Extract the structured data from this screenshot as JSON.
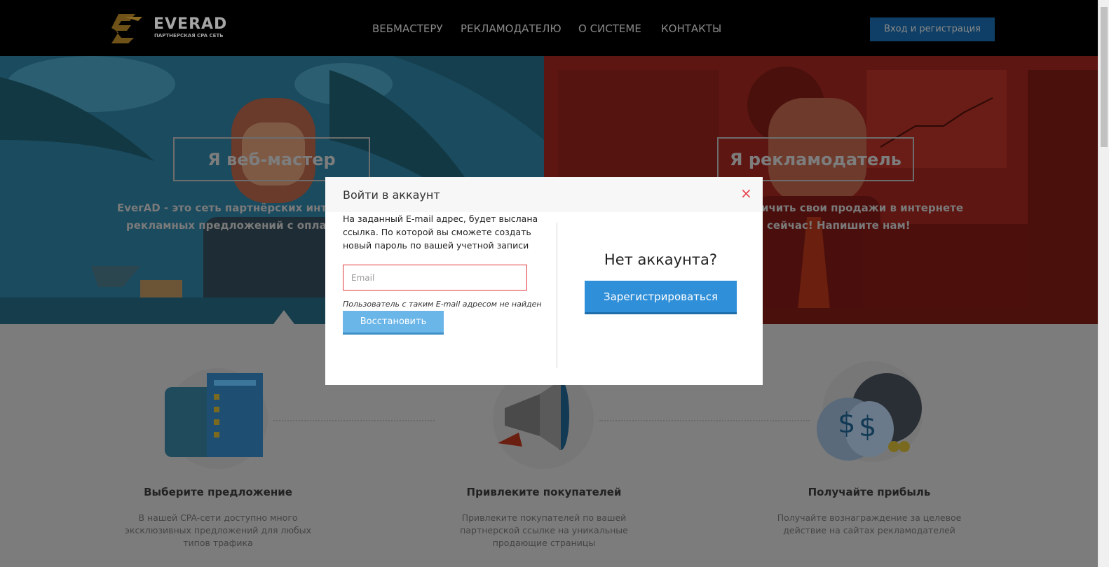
{
  "header": {
    "logo": {
      "name": "EVERAD",
      "tagline": "ПАРТНЕРСКАЯ CPA СЕТЬ"
    },
    "nav": [
      {
        "label": "ВЕБМАСТЕРУ"
      },
      {
        "label": "РЕКЛАМОДАТЕЛЮ"
      },
      {
        "label": "О СИСТЕМЕ"
      },
      {
        "label": "КОНТАКТЫ"
      }
    ],
    "login_button": "Вход и регистрация"
  },
  "hero": {
    "left": {
      "button": "Я веб-мастер",
      "text_line1": "EverAD - это сеть партнёрских инте",
      "text_line2": "рекламных предложений с оплат"
    },
    "right": {
      "button": "Я рекламодатель",
      "text_line1": "ичить свои продажи в интернете",
      "text_line2": "сейчас! Напишите нам!"
    }
  },
  "features": [
    {
      "title": "Выберите предложение",
      "description": "В нашей CPA-сети доступно много эксклюзивных предложений для любых типов трафика"
    },
    {
      "title": "Привлеките покупателей",
      "description": "Привлеките покупателей по вашей партнерской ссылке на уникальные продающие страницы"
    },
    {
      "title": "Получайте прибыль",
      "description": "Получайте вознаграждение за целевое действие на сайтах рекламодателей"
    }
  ],
  "modal": {
    "title": "Войти в аккаунт",
    "close_icon": "close-icon",
    "info": "На заданный E-mail адрес, будет выслана ссылка. По которой вы сможете создать новый пароль по вашей учетной записи",
    "email_placeholder": "Email",
    "email_value": "",
    "error": "Пользователь с таким E-mail адресом не найден",
    "restore_button": "Восстановить",
    "no_account": "Нет аккаунта?",
    "register_button": "Зарегистрироваться"
  },
  "colors": {
    "overlay_header": "#000000",
    "accent_blue": "#2f8fd8",
    "error_red": "#e0383d"
  }
}
